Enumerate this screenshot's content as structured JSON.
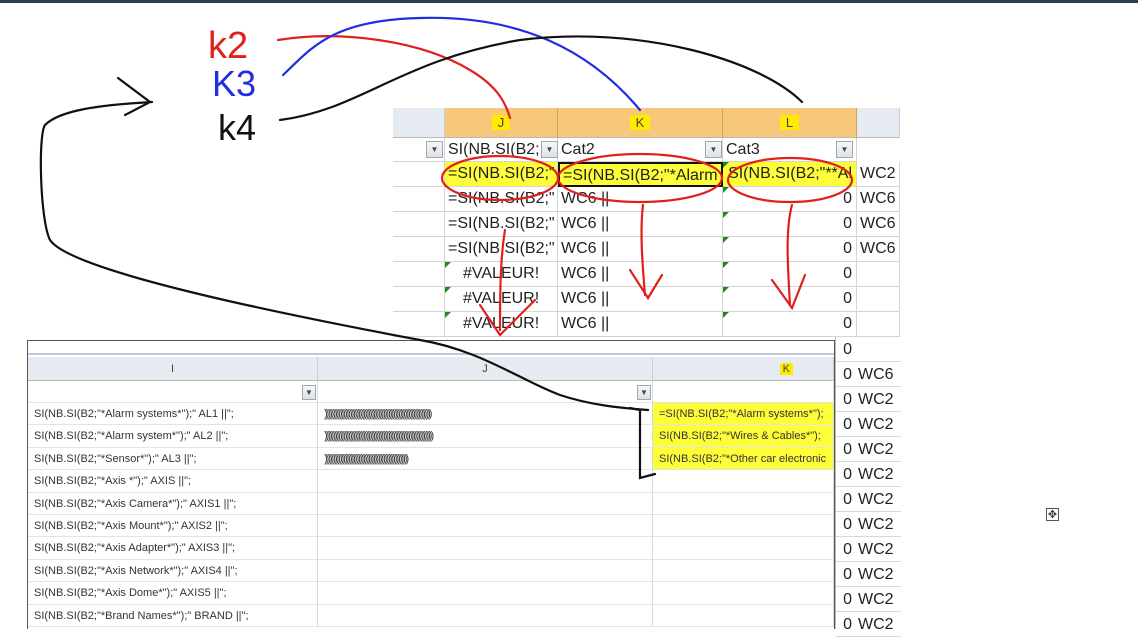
{
  "annotations": {
    "k2": "k2",
    "k3": "K3",
    "k4": "k4"
  },
  "colors": {
    "red": "#e0201c",
    "blue": "#1e2ee0",
    "black": "#111111",
    "highlight": "#fdfd3a",
    "header_active": "#f8c87a"
  },
  "top_sheet": {
    "columns": [
      "J",
      "K",
      "L"
    ],
    "filter_row": [
      "SI(NB.SI(B2;",
      "Cat2",
      "Cat3"
    ],
    "rows": [
      [
        "=SI(NB.SI(B2;\"",
        "=SI(NB.SI(B2;\"*Alarm",
        "SI(NB.SI(B2;\"**Al",
        "WC2"
      ],
      [
        "=SI(NB.SI(B2;\"",
        "WC6 ||",
        "0",
        "WC6"
      ],
      [
        "=SI(NB.SI(B2;\"",
        "WC6 ||",
        "0",
        "WC6"
      ],
      [
        "=SI(NB.SI(B2;\"",
        "WC6 ||",
        "0",
        "WC6"
      ],
      [
        "#VALEUR!",
        "WC6 ||",
        "0",
        ""
      ],
      [
        "#VALEUR!",
        "WC6 ||",
        "0",
        ""
      ],
      [
        "#VALEUR!",
        "WC6 ||",
        "0",
        ""
      ]
    ]
  },
  "bottom_sheet": {
    "columns": [
      "I",
      "J",
      "K"
    ],
    "rows": [
      [
        "SI(NB.SI(B2;\"*Alarm systems*\");\" AL1 ||\";",
        "))))))))))))))))))))))))))))))))))))))))))))))))))))))))))))))))",
        "=SI(NB.SI(B2;\"*Alarm systems*\");"
      ],
      [
        "SI(NB.SI(B2;\"*Alarm system*\");\" AL2 ||\";",
        ")))))))))))))))))))))))))))))))))))))))))))))))))))))))))))))))))",
        "SI(NB.SI(B2;\"*Wires & Cables*\");"
      ],
      [
        "SI(NB.SI(B2;\"*Sensor*\");\" AL3 ||\";",
        "))))))))))))))))))))))))))))))))))))))))))))))))))",
        "SI(NB.SI(B2;\"*Other car electronic"
      ],
      [
        "SI(NB.SI(B2;\"*Axis *\");\" AXIS ||\";",
        "",
        ""
      ],
      [
        "SI(NB.SI(B2;\"*Axis Camera*\");\" AXIS1 ||\";",
        "",
        ""
      ],
      [
        "SI(NB.SI(B2;\"*Axis Mount*\");\" AXIS2 ||\";",
        "",
        ""
      ],
      [
        "SI(NB.SI(B2;\"*Axis Adapter*\");\" AXIS3 ||\";",
        "",
        ""
      ],
      [
        "SI(NB.SI(B2;\"*Axis Network*\");\" AXIS4 ||\";",
        "",
        ""
      ],
      [
        "SI(NB.SI(B2;\"*Axis Dome*\");\" AXIS5 ||\";",
        "",
        ""
      ],
      [
        "SI(NB.SI(B2;\"*Brand Names*\");\" BRAND ||\";",
        "",
        ""
      ]
    ]
  },
  "right_strip": [
    [
      "0",
      ""
    ],
    [
      "0",
      "WC6"
    ],
    [
      "0",
      "WC2"
    ],
    [
      "0",
      "WC2"
    ],
    [
      "0",
      "WC2"
    ],
    [
      "0",
      "WC2"
    ],
    [
      "0",
      "WC2"
    ],
    [
      "0",
      "WC2"
    ],
    [
      "0",
      "WC2"
    ],
    [
      "0",
      "WC2"
    ],
    [
      "0",
      "WC2"
    ],
    [
      "0",
      "WC2"
    ]
  ]
}
